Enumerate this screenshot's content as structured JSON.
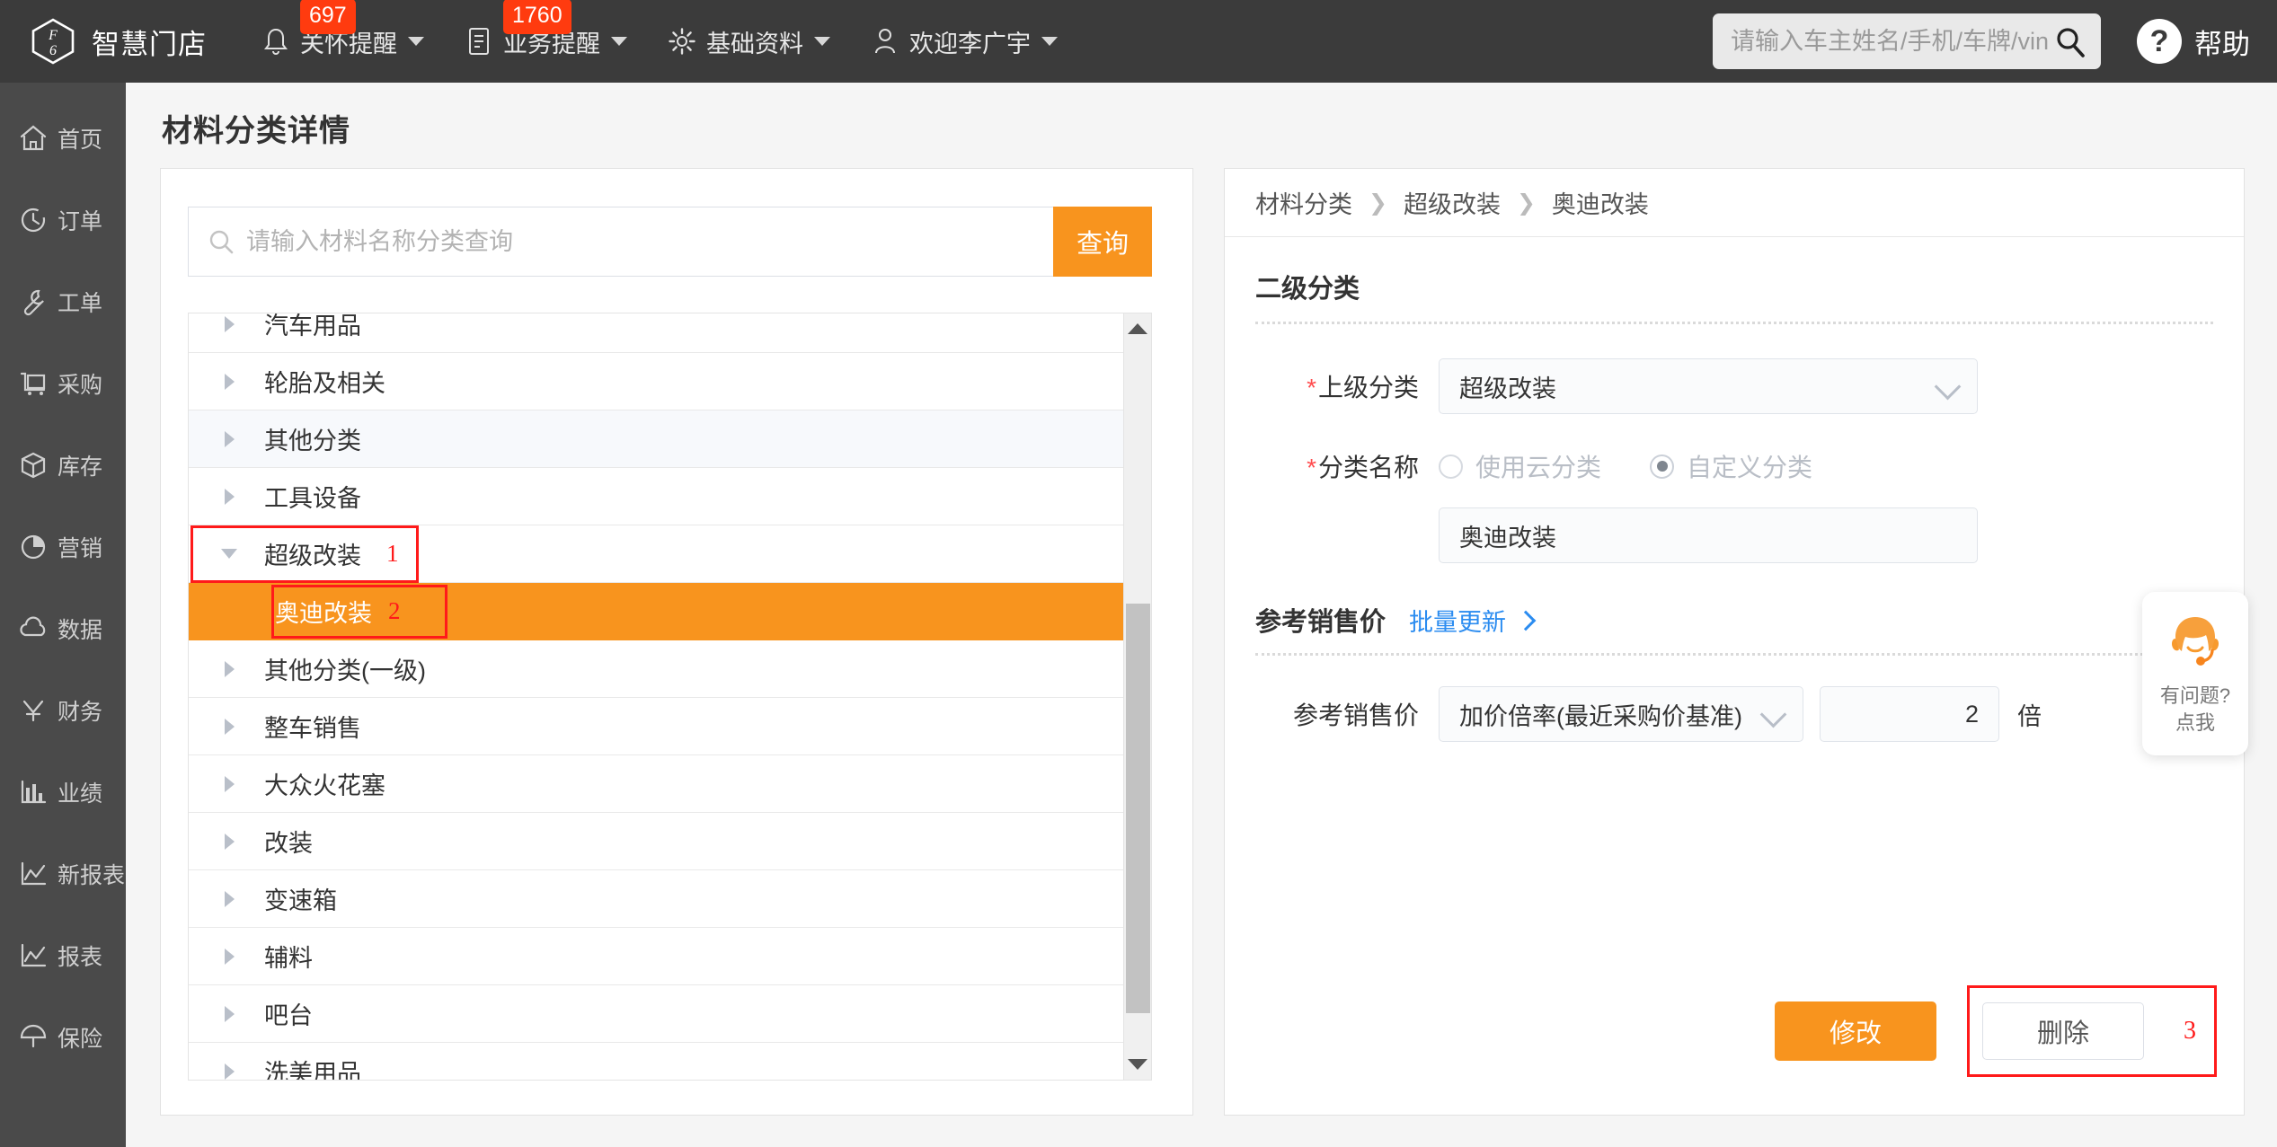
{
  "topbar": {
    "brand": "智慧门店",
    "brand_icon": "f6-hexagon-logo",
    "nav": [
      {
        "label": "关怀提醒",
        "icon": "bell-icon",
        "badge": "697",
        "caret": true
      },
      {
        "label": "业务提醒",
        "icon": "document-icon",
        "badge": "1760",
        "caret": true
      },
      {
        "label": "基础资料",
        "icon": "gear-icon",
        "badge": "",
        "caret": true
      },
      {
        "label": "欢迎李广宇",
        "icon": "user-icon",
        "badge": "",
        "caret": true
      }
    ],
    "search": {
      "placeholder": "请输入车主姓名/手机/车牌/vin码",
      "value": "",
      "icon": "search-icon"
    },
    "help": {
      "label": "帮助",
      "icon": "question-mark-icon"
    }
  },
  "sidebar": {
    "items": [
      {
        "label": "首页",
        "icon": "home-icon"
      },
      {
        "label": "订单",
        "icon": "clock-history-icon"
      },
      {
        "label": "工单",
        "icon": "wrench-icon"
      },
      {
        "label": "采购",
        "icon": "cart-icon"
      },
      {
        "label": "库存",
        "icon": "box-icon"
      },
      {
        "label": "营销",
        "icon": "pie-chart-icon"
      },
      {
        "label": "数据",
        "icon": "cloud-icon"
      },
      {
        "label": "财务",
        "icon": "yuan-icon"
      },
      {
        "label": "业绩",
        "icon": "bar-chart-icon"
      },
      {
        "label": "新报表",
        "icon": "line-chart-icon"
      },
      {
        "label": "报表",
        "icon": "line-chart-icon"
      },
      {
        "label": "保险",
        "icon": "umbrella-icon"
      }
    ]
  },
  "page": {
    "title": "材料分类详情"
  },
  "left_panel": {
    "search": {
      "placeholder": "请输入材料名称分类查询",
      "value": "",
      "icon": "search-icon"
    },
    "query_button": "查询",
    "tree": [
      {
        "label": "汽车用品",
        "level": 1,
        "expanded": false,
        "selected": false,
        "alt": false
      },
      {
        "label": "轮胎及相关",
        "level": 1,
        "expanded": false,
        "selected": false,
        "alt": false
      },
      {
        "label": "其他分类",
        "level": 1,
        "expanded": false,
        "selected": false,
        "alt": true
      },
      {
        "label": "工具设备",
        "level": 1,
        "expanded": false,
        "selected": false,
        "alt": false
      },
      {
        "label": "超级改装",
        "level": 1,
        "expanded": true,
        "selected": false,
        "alt": false,
        "mark": "1",
        "highlight": true
      },
      {
        "label": "奥迪改装",
        "level": 2,
        "expanded": false,
        "selected": true,
        "alt": false,
        "mark": "2",
        "highlight": true
      },
      {
        "label": "其他分类(一级)",
        "level": 1,
        "expanded": false,
        "selected": false,
        "alt": false
      },
      {
        "label": "整车销售",
        "level": 1,
        "expanded": false,
        "selected": false,
        "alt": false
      },
      {
        "label": "大众火花塞",
        "level": 1,
        "expanded": false,
        "selected": false,
        "alt": false
      },
      {
        "label": "改装",
        "level": 1,
        "expanded": false,
        "selected": false,
        "alt": false
      },
      {
        "label": "变速箱",
        "level": 1,
        "expanded": false,
        "selected": false,
        "alt": false
      },
      {
        "label": "辅料",
        "level": 1,
        "expanded": false,
        "selected": false,
        "alt": false
      },
      {
        "label": "吧台",
        "level": 1,
        "expanded": false,
        "selected": false,
        "alt": false
      },
      {
        "label": "洗美用品",
        "level": 1,
        "expanded": false,
        "selected": false,
        "alt": false
      }
    ],
    "scrollbar": {
      "up_icon": "triangle-up-icon",
      "down_icon": "triangle-down-icon"
    }
  },
  "right_panel": {
    "breadcrumb": [
      "材料分类",
      "超级改装",
      "奥迪改装"
    ],
    "section_title": "二级分类",
    "parent_category": {
      "label": "上级分类",
      "required": true,
      "value": "超级改装",
      "icon": "chevron-down-icon"
    },
    "category_name": {
      "label": "分类名称",
      "required": true,
      "options": [
        {
          "label": "使用云分类",
          "selected": false
        },
        {
          "label": "自定义分类",
          "selected": true
        }
      ],
      "value": "奥迪改装"
    },
    "price_section": {
      "title": "参考销售价",
      "batch_link": "批量更新",
      "row_label": "参考销售价",
      "mode_value": "加价倍率(最近采购价基准)",
      "multiplier": "2",
      "unit": "倍"
    },
    "buttons": {
      "modify": "修改",
      "delete": "删除",
      "delete_mark": "3"
    }
  },
  "service_widget": {
    "line1": "有问题?",
    "line2": "点我",
    "icon": "headset-operator-icon"
  },
  "colors": {
    "accent": "#f8941e",
    "badge": "#ff3b0f",
    "topbar": "#3b3b3b",
    "sidebar": "#4a4a4a",
    "link": "#2b8cf0",
    "mark": "#ff1a1a"
  }
}
